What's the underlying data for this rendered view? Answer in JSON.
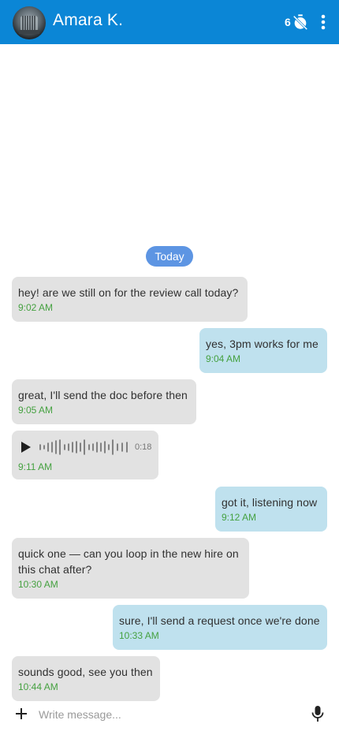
{
  "header": {
    "contact_name": "Amara K.",
    "timer_count": "6",
    "timer_icon": "timer-off-icon",
    "menu_icon": "more-vert-icon",
    "accent": "#0b86d6"
  },
  "chat": {
    "date_label": "Today",
    "messages": [
      {
        "dir": "in",
        "text": "hey! are we still on for the review call today?",
        "time": "9:02 AM"
      },
      {
        "dir": "out",
        "text": "yes, 3pm works for me",
        "time": "9:04 AM"
      },
      {
        "dir": "in",
        "text": "great, I'll send the doc before then",
        "time": "9:05 AM"
      },
      {
        "dir": "in",
        "type": "voice",
        "duration": "0:18",
        "time": "9:11 AM"
      },
      {
        "dir": "out",
        "text": "got it, listening now",
        "time": "9:12 AM"
      },
      {
        "dir": "in",
        "text": "quick one — can you loop in the new hire on this chat after?",
        "time": "10:30 AM"
      },
      {
        "dir": "out",
        "text": "sure, I'll send a request once we're done",
        "time": "10:33 AM"
      },
      {
        "dir": "in",
        "text": "sounds good, see you then",
        "time": "10:44 AM"
      }
    ]
  },
  "composer": {
    "placeholder": "Write message...",
    "value": "",
    "add_icon": "plus-icon",
    "mic_icon": "mic-icon"
  },
  "colors": {
    "incoming_bubble": "#e2e2e2",
    "outgoing_bubble": "#bfe1ee",
    "timestamp": "#45a140",
    "date_chip": "#5d95e3"
  }
}
